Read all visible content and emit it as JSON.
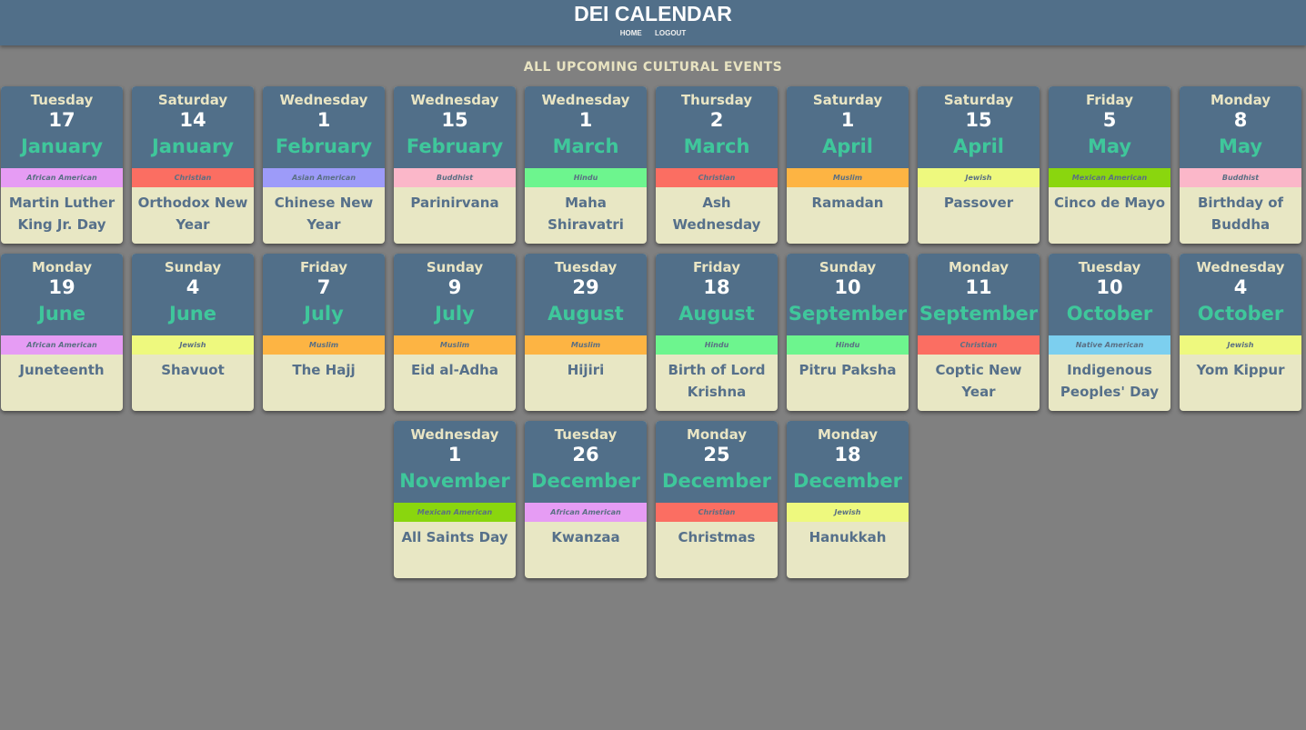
{
  "app": {
    "title": "DEI CALENDAR",
    "nav": [
      "HOME",
      "LOGOUT"
    ]
  },
  "page_heading": "ALL UPCOMING CULTURAL EVENTS",
  "category_colors": {
    "African American": "#e69cf4",
    "Christian": "#fb6e62",
    "Asian American": "#9d9bf9",
    "Buddhist": "#fbb7c9",
    "Hindu": "#6df58e",
    "Muslim": "#fdb443",
    "Jewish": "#eef97e",
    "Mexican American": "#8ad60e",
    "Native American": "#7ccfef"
  },
  "events": [
    {
      "weekday": "Tuesday",
      "day": "17",
      "month": "January",
      "category": "African American",
      "name": "Martin Luther King Jr. Day"
    },
    {
      "weekday": "Saturday",
      "day": "14",
      "month": "January",
      "category": "Christian",
      "name": "Orthodox New Year"
    },
    {
      "weekday": "Wednesday",
      "day": "1",
      "month": "February",
      "category": "Asian American",
      "name": "Chinese New Year"
    },
    {
      "weekday": "Wednesday",
      "day": "15",
      "month": "February",
      "category": "Buddhist",
      "name": "Parinirvana"
    },
    {
      "weekday": "Wednesday",
      "day": "1",
      "month": "March",
      "category": "Hindu",
      "name": "Maha Shiravatri"
    },
    {
      "weekday": "Thursday",
      "day": "2",
      "month": "March",
      "category": "Christian",
      "name": "Ash Wednesday"
    },
    {
      "weekday": "Saturday",
      "day": "1",
      "month": "April",
      "category": "Muslim",
      "name": "Ramadan"
    },
    {
      "weekday": "Saturday",
      "day": "15",
      "month": "April",
      "category": "Jewish",
      "name": "Passover"
    },
    {
      "weekday": "Friday",
      "day": "5",
      "month": "May",
      "category": "Mexican American",
      "name": "Cinco de Mayo"
    },
    {
      "weekday": "Monday",
      "day": "8",
      "month": "May",
      "category": "Buddhist",
      "name": "Birthday of Buddha"
    },
    {
      "weekday": "Monday",
      "day": "19",
      "month": "June",
      "category": "African American",
      "name": "Juneteenth"
    },
    {
      "weekday": "Sunday",
      "day": "4",
      "month": "June",
      "category": "Jewish",
      "name": "Shavuot"
    },
    {
      "weekday": "Friday",
      "day": "7",
      "month": "July",
      "category": "Muslim",
      "name": "The Hajj"
    },
    {
      "weekday": "Sunday",
      "day": "9",
      "month": "July",
      "category": "Muslim",
      "name": "Eid al-Adha"
    },
    {
      "weekday": "Tuesday",
      "day": "29",
      "month": "August",
      "category": "Muslim",
      "name": "Hijiri"
    },
    {
      "weekday": "Friday",
      "day": "18",
      "month": "August",
      "category": "Hindu",
      "name": "Birth of Lord Krishna"
    },
    {
      "weekday": "Sunday",
      "day": "10",
      "month": "September",
      "category": "Hindu",
      "name": "Pitru Paksha"
    },
    {
      "weekday": "Monday",
      "day": "11",
      "month": "September",
      "category": "Christian",
      "name": "Coptic New Year"
    },
    {
      "weekday": "Tuesday",
      "day": "10",
      "month": "October",
      "category": "Native American",
      "name": "Indigenous Peoples' Day"
    },
    {
      "weekday": "Wednesday",
      "day": "4",
      "month": "October",
      "category": "Jewish",
      "name": "Yom Kippur"
    },
    {
      "weekday": "Wednesday",
      "day": "1",
      "month": "November",
      "category": "Mexican American",
      "name": "All Saints Day"
    },
    {
      "weekday": "Tuesday",
      "day": "26",
      "month": "December",
      "category": "African American",
      "name": "Kwanzaa"
    },
    {
      "weekday": "Monday",
      "day": "25",
      "month": "December",
      "category": "Christian",
      "name": "Christmas"
    },
    {
      "weekday": "Monday",
      "day": "18",
      "month": "December",
      "category": "Jewish",
      "name": "Hanukkah"
    }
  ]
}
